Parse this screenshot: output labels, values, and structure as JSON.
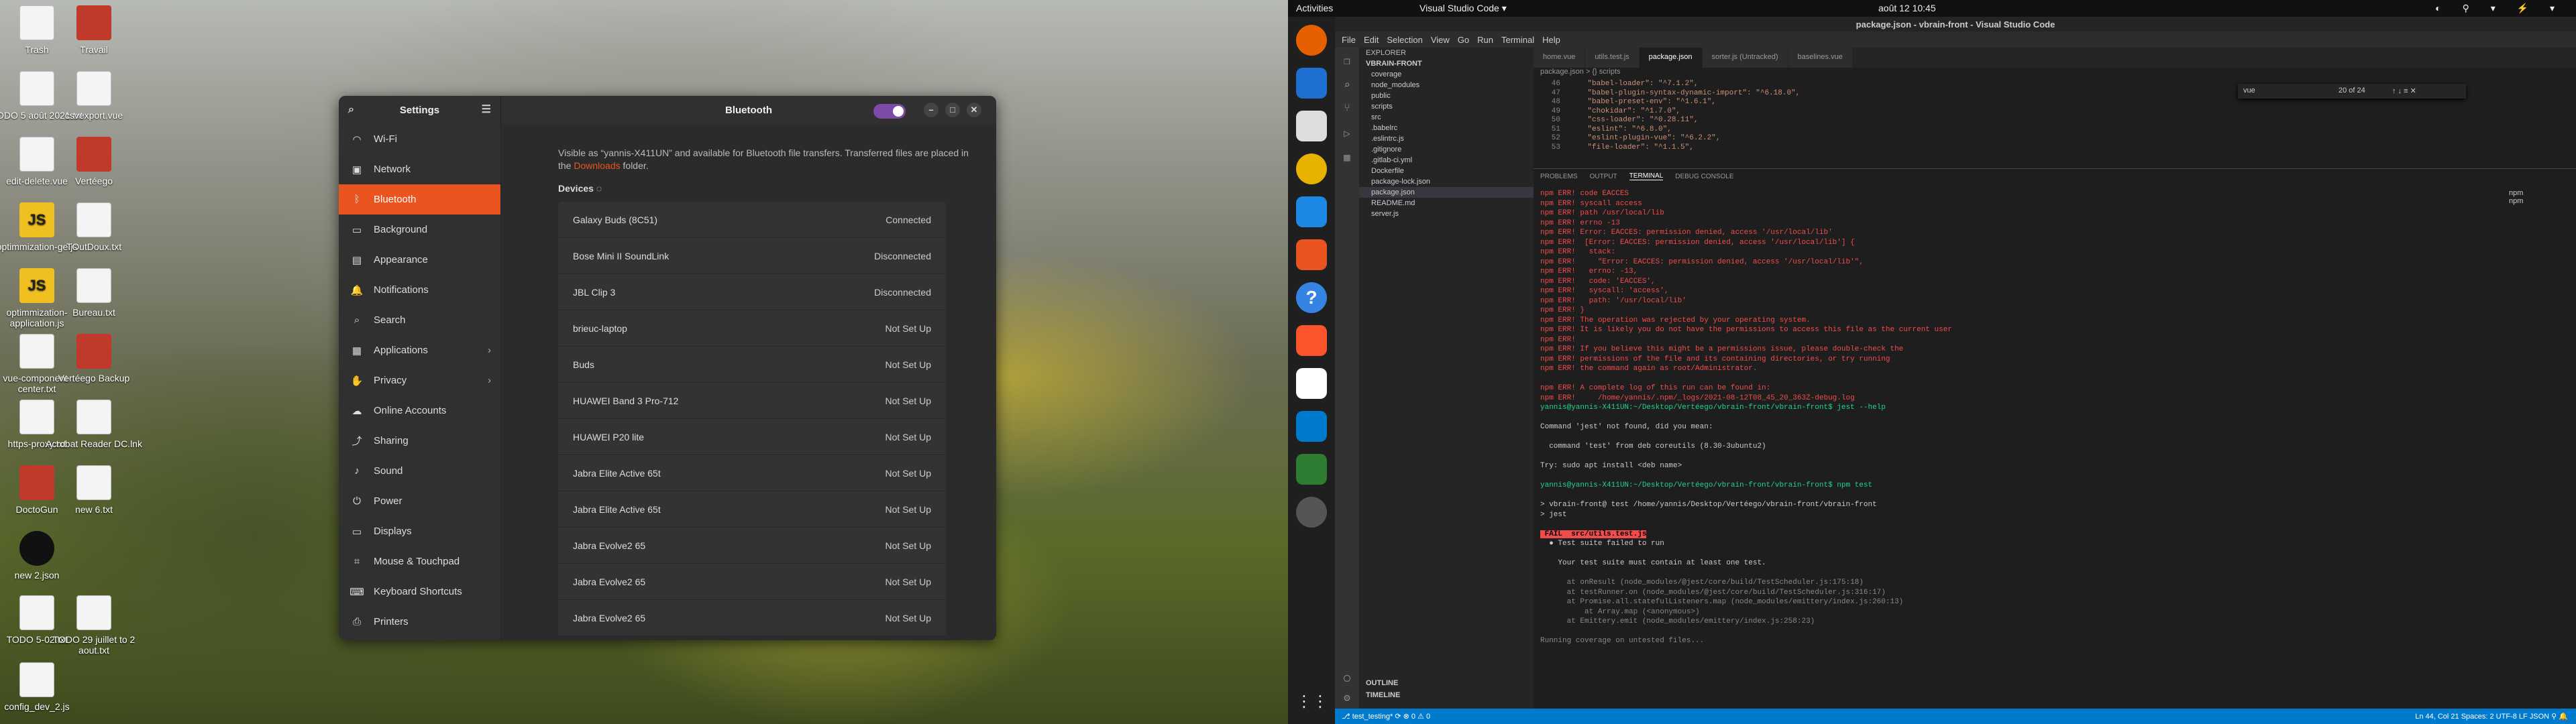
{
  "desktop": {
    "icons": [
      {
        "label": "Trash",
        "x": "t1"
      },
      {
        "label": "Travail",
        "x": "t2"
      },
      {
        "label": "TODO 5 août 2021.txt"
      },
      {
        "label": "csvexport.vue"
      },
      {
        "label": "edit-delete.vue"
      },
      {
        "label": "Vertéego"
      },
      {
        "label": "optimmization-ge.js"
      },
      {
        "label": "TOutDoux.txt"
      },
      {
        "label": "optimmization-application.js"
      },
      {
        "label": "Bureau.txt"
      },
      {
        "label": "vue-component-center.txt"
      },
      {
        "label": "Vertéego Backup"
      },
      {
        "label": "https-proxy.txt"
      },
      {
        "label": "Acrobat Reader DC.lnk"
      },
      {
        "label": "DoctoGun"
      },
      {
        "label": "new 6.txt"
      },
      {
        "label": "new 2.json"
      },
      {
        "label": "TODO 5-02.txt"
      },
      {
        "label": "TODO 29 juillet to 2 aout.txt"
      },
      {
        "label": "config_dev_2.js"
      }
    ]
  },
  "settings": {
    "title": "Settings",
    "panel_title": "Bluetooth",
    "sidebar": [
      {
        "icon": "wifi-icon",
        "glyph": "◠",
        "label": "Wi-Fi"
      },
      {
        "icon": "network-icon",
        "glyph": "▣",
        "label": "Network"
      },
      {
        "icon": "bluetooth-icon",
        "glyph": "ᛒ",
        "label": "Bluetooth"
      },
      {
        "icon": "background-icon",
        "glyph": "▭",
        "label": "Background"
      },
      {
        "icon": "appearance-icon",
        "glyph": "▤",
        "label": "Appearance"
      },
      {
        "icon": "notifications-icon",
        "glyph": "🔔",
        "label": "Notifications"
      },
      {
        "icon": "search-icon",
        "glyph": "⌕",
        "label": "Search"
      },
      {
        "icon": "applications-icon",
        "glyph": "▦",
        "label": "Applications"
      },
      {
        "icon": "privacy-icon",
        "glyph": "✋",
        "label": "Privacy"
      },
      {
        "icon": "online-accounts-icon",
        "glyph": "☁",
        "label": "Online Accounts"
      },
      {
        "icon": "sharing-icon",
        "glyph": "⤴",
        "label": "Sharing"
      },
      {
        "icon": "sound-icon",
        "glyph": "♪",
        "label": "Sound"
      },
      {
        "icon": "power-icon",
        "glyph": "⏻",
        "label": "Power"
      },
      {
        "icon": "displays-icon",
        "glyph": "▭",
        "label": "Displays"
      },
      {
        "icon": "mouse-icon",
        "glyph": "⌗",
        "label": "Mouse & Touchpad"
      },
      {
        "icon": "keyboard-icon",
        "glyph": "⌨",
        "label": "Keyboard Shortcuts"
      },
      {
        "icon": "printers-icon",
        "glyph": "⎙",
        "label": "Printers"
      }
    ],
    "visible_text_1": "Visible as “yannis-X411UN” and available for Bluetooth file transfers. Transferred files are placed in the ",
    "visible_link": "Downloads",
    "visible_text_2": " folder.",
    "devices_label": "Devices",
    "devices": [
      {
        "name": "Galaxy Buds (8C51)",
        "status": "Connected"
      },
      {
        "name": "Bose Mini II SoundLink",
        "status": "Disconnected"
      },
      {
        "name": "JBL Clip 3",
        "status": "Disconnected"
      },
      {
        "name": "brieuc-laptop",
        "status": "Not Set Up"
      },
      {
        "name": "Buds",
        "status": "Not Set Up"
      },
      {
        "name": "HUAWEI Band 3 Pro-712",
        "status": "Not Set Up"
      },
      {
        "name": "HUAWEI P20 lite",
        "status": "Not Set Up"
      },
      {
        "name": "Jabra Elite Active 65t",
        "status": "Not Set Up"
      },
      {
        "name": "Jabra Elite Active 65t",
        "status": "Not Set Up"
      },
      {
        "name": "Jabra Evolve2 65",
        "status": "Not Set Up"
      },
      {
        "name": "Jabra Evolve2 65",
        "status": "Not Set Up"
      },
      {
        "name": "Jabra Evolve2 65",
        "status": "Not Set Up"
      }
    ]
  },
  "topbar": {
    "activities": "Activities",
    "app": "Visual Studio Code ▾",
    "clock": "août 12  10:45"
  },
  "vscode": {
    "title": "package.json - vbrain-front - Visual Studio Code",
    "menu": [
      "File",
      "Edit",
      "Selection",
      "View",
      "Go",
      "Run",
      "Terminal",
      "Help"
    ],
    "explorer_title": "EXPLORER",
    "project": "VBRAIN-FRONT",
    "files": [
      "coverage",
      "node_modules",
      "public",
      "scripts",
      "src",
      ".babelrc",
      ".eslintrc.js",
      ".gitignore",
      ".gitlab-ci.yml",
      "Dockerfile",
      "package-lock.json",
      "package.json",
      "README.md",
      "server.js"
    ],
    "outline": "OUTLINE",
    "timeline": "TIMELINE",
    "tabs": [
      "home.vue",
      "utils.test.js",
      "package.json",
      "sorter.js (Untracked)",
      "baselines.vue"
    ],
    "breadcrumb": "package.json > {} scripts",
    "find_value": "vue",
    "find_count": "20 of 24",
    "code": [
      {
        "n": "46",
        "t": "    \"babel-loader\": \"^7.1.2\","
      },
      {
        "n": "47",
        "t": "    \"babel-plugin-syntax-dynamic-import\": \"^6.18.0\","
      },
      {
        "n": "48",
        "t": "    \"babel-preset-env\": \"^1.6.1\","
      },
      {
        "n": "49",
        "t": "    \"chokidar\": \"^1.7.0\","
      },
      {
        "n": "50",
        "t": "    \"css-loader\": \"^0.28.11\","
      },
      {
        "n": "51",
        "t": "    \"eslint\": \"^6.8.0\","
      },
      {
        "n": "52",
        "t": "    \"eslint-plugin-vue\": \"^6.2.2\","
      },
      {
        "n": "53",
        "t": "    \"file-loader\": \"^1.1.5\","
      }
    ],
    "panel_tabs": [
      "PROBLEMS",
      "OUTPUT",
      "TERMINAL",
      "DEBUG CONSOLE"
    ],
    "terminal": [
      {
        "c": "err",
        "t": "npm ERR! code EACCES"
      },
      {
        "c": "err",
        "t": "npm ERR! syscall access"
      },
      {
        "c": "err",
        "t": "npm ERR! path /usr/local/lib"
      },
      {
        "c": "err",
        "t": "npm ERR! errno -13"
      },
      {
        "c": "err",
        "t": "npm ERR! Error: EACCES: permission denied, access '/usr/local/lib'"
      },
      {
        "c": "err",
        "t": "npm ERR!  [Error: EACCES: permission denied, access '/usr/local/lib'] {"
      },
      {
        "c": "err",
        "t": "npm ERR!   stack:"
      },
      {
        "c": "err",
        "t": "npm ERR!     \"Error: EACCES: permission denied, access '/usr/local/lib'\","
      },
      {
        "c": "err",
        "t": "npm ERR!   errno: -13,"
      },
      {
        "c": "err",
        "t": "npm ERR!   code: 'EACCES',"
      },
      {
        "c": "err",
        "t": "npm ERR!   syscall: 'access',"
      },
      {
        "c": "err",
        "t": "npm ERR!   path: '/usr/local/lib'"
      },
      {
        "c": "err",
        "t": "npm ERR! }"
      },
      {
        "c": "err",
        "t": "npm ERR! The operation was rejected by your operating system."
      },
      {
        "c": "err",
        "t": "npm ERR! It is likely you do not have the permissions to access this file as the current user"
      },
      {
        "c": "err",
        "t": "npm ERR!"
      },
      {
        "c": "err",
        "t": "npm ERR! If you believe this might be a permissions issue, please double-check the"
      },
      {
        "c": "err",
        "t": "npm ERR! permissions of the file and its containing directories, or try running"
      },
      {
        "c": "err",
        "t": "npm ERR! the command again as root/Administrator."
      },
      {
        "c": "",
        "t": ""
      },
      {
        "c": "err",
        "t": "npm ERR! A complete log of this run can be found in:"
      },
      {
        "c": "err",
        "t": "npm ERR!     /home/yannis/.npm/_logs/2021-08-12T08_45_20_363Z-debug.log"
      },
      {
        "c": "grn",
        "t": "yannis@yannis-X411UN:~/Desktop/Vertéego/vbrain-front/vbrain-front$ jest --help"
      },
      {
        "c": "",
        "t": ""
      },
      {
        "c": "",
        "t": "Command 'jest' not found, did you mean:"
      },
      {
        "c": "",
        "t": ""
      },
      {
        "c": "",
        "t": "  command 'test' from deb coreutils (8.30-3ubuntu2)"
      },
      {
        "c": "",
        "t": ""
      },
      {
        "c": "",
        "t": "Try: sudo apt install <deb name>"
      },
      {
        "c": "",
        "t": ""
      },
      {
        "c": "grn",
        "t": "yannis@yannis-X411UN:~/Desktop/Vertéego/vbrain-front/vbrain-front$ npm test"
      },
      {
        "c": "",
        "t": ""
      },
      {
        "c": "",
        "t": "> vbrain-front@ test /home/yannis/Desktop/Vertéego/vbrain-front/vbrain-front"
      },
      {
        "c": "",
        "t": "> jest"
      },
      {
        "c": "",
        "t": ""
      },
      {
        "c": "fail",
        "t": " FAIL  src/utils.test.js"
      },
      {
        "c": "",
        "t": "  ● Test suite failed to run"
      },
      {
        "c": "",
        "t": ""
      },
      {
        "c": "",
        "t": "    Your test suite must contain at least one test."
      },
      {
        "c": "",
        "t": ""
      },
      {
        "c": "gry",
        "t": "      at onResult (node_modules/@jest/core/build/TestScheduler.js:175:18)"
      },
      {
        "c": "gry",
        "t": "      at testRunner.on (node_modules/@jest/core/build/TestScheduler.js:316:17)"
      },
      {
        "c": "gry",
        "t": "      at Promise.all.statefulListeners.map (node_modules/emittery/index.js:260:13)"
      },
      {
        "c": "gry",
        "t": "          at Array.map (<anonymous>)"
      },
      {
        "c": "gry",
        "t": "      at Emittery.emit (node_modules/emittery/index.js:258:23)"
      },
      {
        "c": "",
        "t": ""
      },
      {
        "c": "gry",
        "t": "Running coverage on untested files..."
      }
    ],
    "term_list": [
      "npm",
      "npm"
    ],
    "status_left": "⎇ test_testing*  ⟳  ⊗ 0 ⚠ 0",
    "status_right": "Ln 44, Col 21   Spaces: 2   UTF-8   LF   JSON   ⚲   🔔"
  }
}
